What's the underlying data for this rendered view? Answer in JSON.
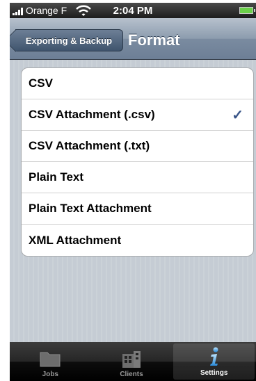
{
  "status_bar": {
    "carrier": "Orange F",
    "time": "2:04 PM"
  },
  "nav": {
    "back_label": "Exporting & Backup",
    "title": "Format"
  },
  "formats": [
    {
      "label": "CSV",
      "selected": false
    },
    {
      "label": "CSV Attachment (.csv)",
      "selected": true
    },
    {
      "label": "CSV Attachment (.txt)",
      "selected": false
    },
    {
      "label": "Plain Text",
      "selected": false
    },
    {
      "label": "Plain Text Attachment",
      "selected": false
    },
    {
      "label": "XML Attachment",
      "selected": false
    }
  ],
  "checkmark": "✓",
  "tabs": [
    {
      "label": "Jobs",
      "icon": "folder-icon",
      "active": false
    },
    {
      "label": "Clients",
      "icon": "building-icon",
      "active": false
    },
    {
      "label": "Settings",
      "icon": "info-icon",
      "active": true
    }
  ],
  "colors": {
    "checkmark": "#385487",
    "nav_bar": "#8c9cae",
    "background": "#c5ccd4"
  }
}
